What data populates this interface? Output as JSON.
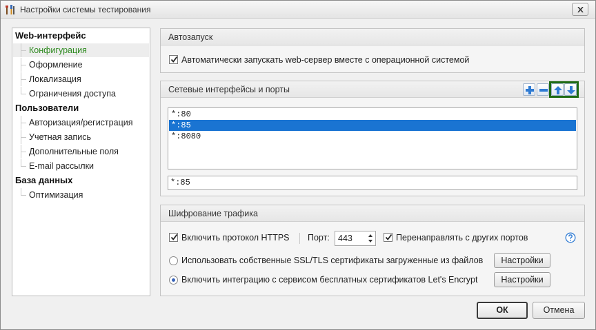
{
  "window": {
    "title": "Настройки системы тестирования",
    "icons": {
      "app": "tools-icon",
      "close": "close-icon"
    }
  },
  "nav": {
    "categories": [
      {
        "label": "Web-интерфейс",
        "items": [
          "Конфигурация",
          "Оформление",
          "Локализация",
          "Ограничения доступа"
        ]
      },
      {
        "label": "Пользователи",
        "items": [
          "Авторизация/регистрация",
          "Учетная запись",
          "Дополнительные поля",
          "E-mail рассылки"
        ]
      },
      {
        "label": "База данных",
        "items": [
          "Оптимизация"
        ]
      }
    ],
    "selected": "Конфигурация",
    "selected_color": "#2d8a1f"
  },
  "autostart": {
    "title": "Автозапуск",
    "checkbox_label": "Автоматически запускать web-сервер вместе с операционной системой",
    "checked": true
  },
  "interfaces": {
    "title": "Сетевые интерфейсы и порты",
    "toolbar": [
      "add-icon",
      "remove-icon",
      "move-up-icon",
      "move-down-icon"
    ],
    "list": [
      "*:80",
      "*:85",
      "*:8080"
    ],
    "selected_index": 1,
    "edit_value": "*:85",
    "selection_color": "#1a74d2",
    "highlight_color": "#1e6b14"
  },
  "encryption": {
    "title": "Шифрование трафика",
    "https_label": "Включить протокол HTTPS",
    "https_checked": true,
    "port_label": "Порт:",
    "port_value": "443",
    "redirect_label": "Перенаправлять с других портов",
    "redirect_checked": true,
    "help_icon": "help-icon",
    "option_own": "Использовать собственные SSL/TLS сертификаты загруженные из файлов",
    "option_letsencrypt": "Включить интеграцию с сервисом бесплатных сертификатов Let's Encrypt",
    "selected_option": "letsencrypt",
    "settings_label": "Настройки"
  },
  "footer": {
    "ok": "ОК",
    "cancel": "Отмена"
  }
}
